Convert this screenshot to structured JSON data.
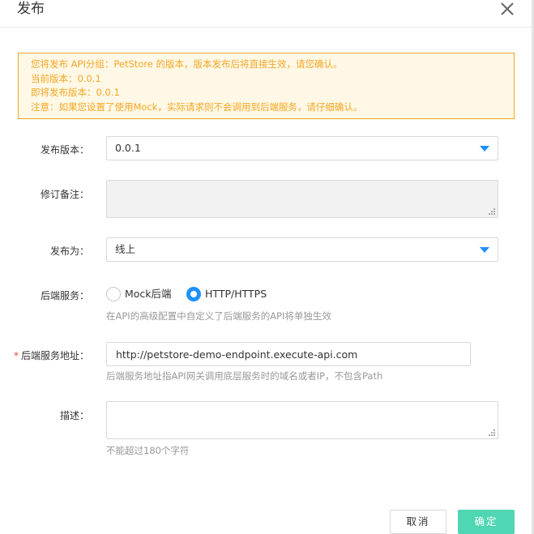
{
  "dialog": {
    "title": "发布"
  },
  "notice": {
    "lines": [
      "您将发布 API分组：PetStore 的版本，版本发布后将直接生效，请您确认。",
      "当前版本：0.0.1",
      "即将发布版本：0.0.1",
      "注意：如果您设置了使用Mock，实际请求则不会调用到后端服务，请仔细确认。"
    ]
  },
  "form": {
    "version": {
      "label": "发布版本：",
      "value": "0.0.1"
    },
    "remark": {
      "label": "修订备注：",
      "value": ""
    },
    "publish_to": {
      "label": "发布为：",
      "value": "线上"
    },
    "backend": {
      "label": "后端服务：",
      "options": [
        "Mock后端",
        "HTTP/HTTPS"
      ],
      "selected": "HTTP/HTTPS",
      "hint": "在API的高级配置中自定义了后端服务的API将单独生效"
    },
    "backend_address": {
      "required_mark": "*",
      "label": "后端服务地址：",
      "value": "http://petstore-demo-endpoint.execute-api.com",
      "hint": "后端服务地址指API网关调用底层服务时的域名或者IP，不包含Path"
    },
    "description": {
      "label": "描述：",
      "value": "",
      "hint": "不能超过180个字符"
    }
  },
  "footer": {
    "cancel_label": "取消",
    "ok_label": "确定"
  },
  "colors": {
    "accent": "#1e90ff",
    "warning": "#f5a623",
    "primary_button": "#4fd6b2"
  }
}
